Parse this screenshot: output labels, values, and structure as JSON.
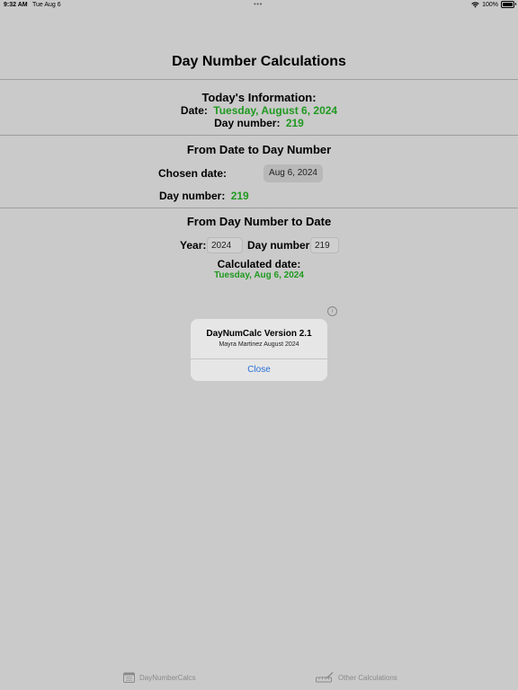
{
  "status_bar": {
    "time": "9:32 AM",
    "date": "Tue Aug 6",
    "dots": "•••",
    "battery": "100%"
  },
  "title": "Day Number Calculations",
  "today": {
    "heading": "Today's Information:",
    "date_label": "Date:",
    "date_value": "Tuesday, August 6, 2024",
    "day_label": "Day number:",
    "day_value": "219"
  },
  "date_to_day": {
    "heading": "From Date to Day Number",
    "chosen_label": "Chosen date:",
    "chosen_value": "Aug 6, 2024",
    "day_label": "Day number:",
    "day_value": "219"
  },
  "day_to_date": {
    "heading": "From Day Number to Date",
    "year_label": "Year:",
    "year_value": "2024",
    "day_label": "Day number:",
    "day_value": "219",
    "calc_label": "Calculated date:",
    "calc_value": "Tuesday, Aug 6, 2024"
  },
  "info_icon": "info-icon",
  "alert": {
    "title": "DayNumCalc Version 2.1",
    "message": "Mayra Martinez August 2024",
    "close_label": "Close"
  },
  "tabs": [
    {
      "label": "DayNumberCalcs",
      "icon": "calendar-icon"
    },
    {
      "label": "Other Calculations",
      "icon": "ruler-pencil-icon"
    }
  ],
  "colors": {
    "accent_green": "#1f9a1f",
    "link_blue": "#2a6fd8",
    "background": "#cacaca"
  }
}
